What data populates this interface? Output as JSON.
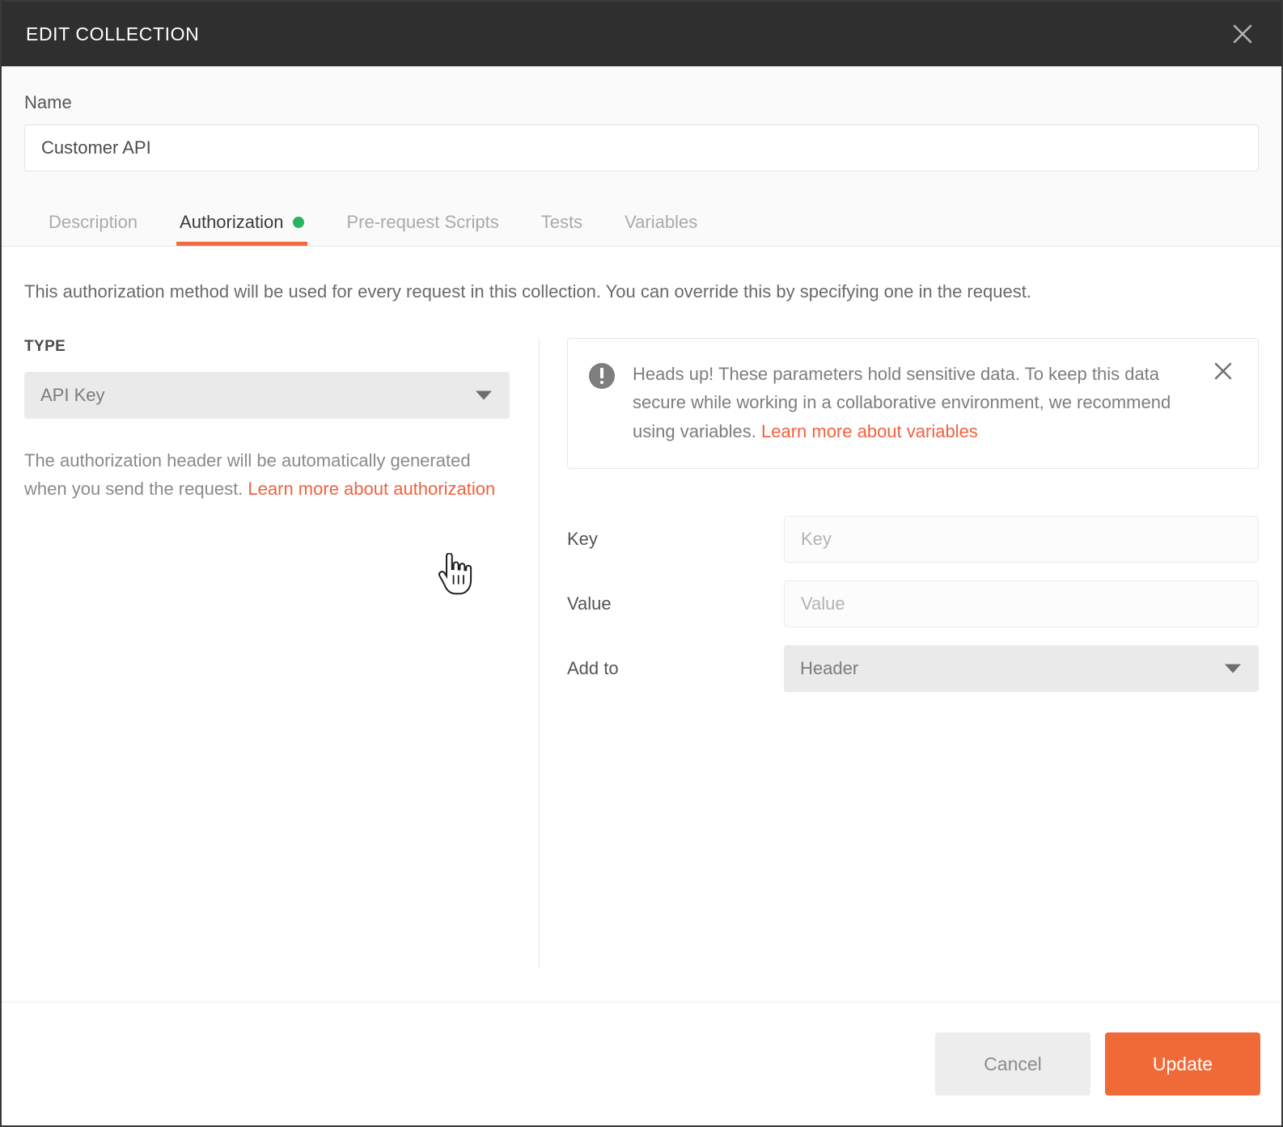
{
  "titlebar": {
    "title": "EDIT COLLECTION",
    "close_icon": "close-icon"
  },
  "name_field": {
    "label": "Name",
    "value": "Customer API",
    "placeholder": "Name"
  },
  "tabs": [
    {
      "label": "Description",
      "active": false,
      "dot": false
    },
    {
      "label": "Authorization",
      "active": true,
      "dot": true
    },
    {
      "label": "Pre-request Scripts",
      "active": false,
      "dot": false
    },
    {
      "label": "Tests",
      "active": false,
      "dot": false
    },
    {
      "label": "Variables",
      "active": false,
      "dot": false
    }
  ],
  "intro": "This authorization method will be used for every request in this collection. You can override this by specifying one in the request.",
  "left": {
    "type_label": "TYPE",
    "type_value": "API Key",
    "helper_text": "The authorization header will be automatically generated when you send the request. ",
    "helper_link": "Learn more about authorization"
  },
  "alert": {
    "icon": "exclamation-circle-icon",
    "text": "Heads up! These parameters hold sensitive data. To keep this data secure while working in a collaborative environment, we recommend using variables. ",
    "link": "Learn more about variables",
    "close_icon": "close-icon"
  },
  "form": {
    "rows": [
      {
        "label": "Key",
        "placeholder": "Key",
        "value": "",
        "kind": "input"
      },
      {
        "label": "Value",
        "placeholder": "Value",
        "value": "",
        "kind": "input"
      },
      {
        "label": "Add to",
        "value": "Header",
        "kind": "select"
      }
    ]
  },
  "footer": {
    "cancel_label": "Cancel",
    "update_label": "Update"
  },
  "colors": {
    "accent_orange": "#f06a37",
    "link_orange": "#f2613f",
    "status_green": "#28b463",
    "titlebar_bg": "#2f2f2f"
  }
}
